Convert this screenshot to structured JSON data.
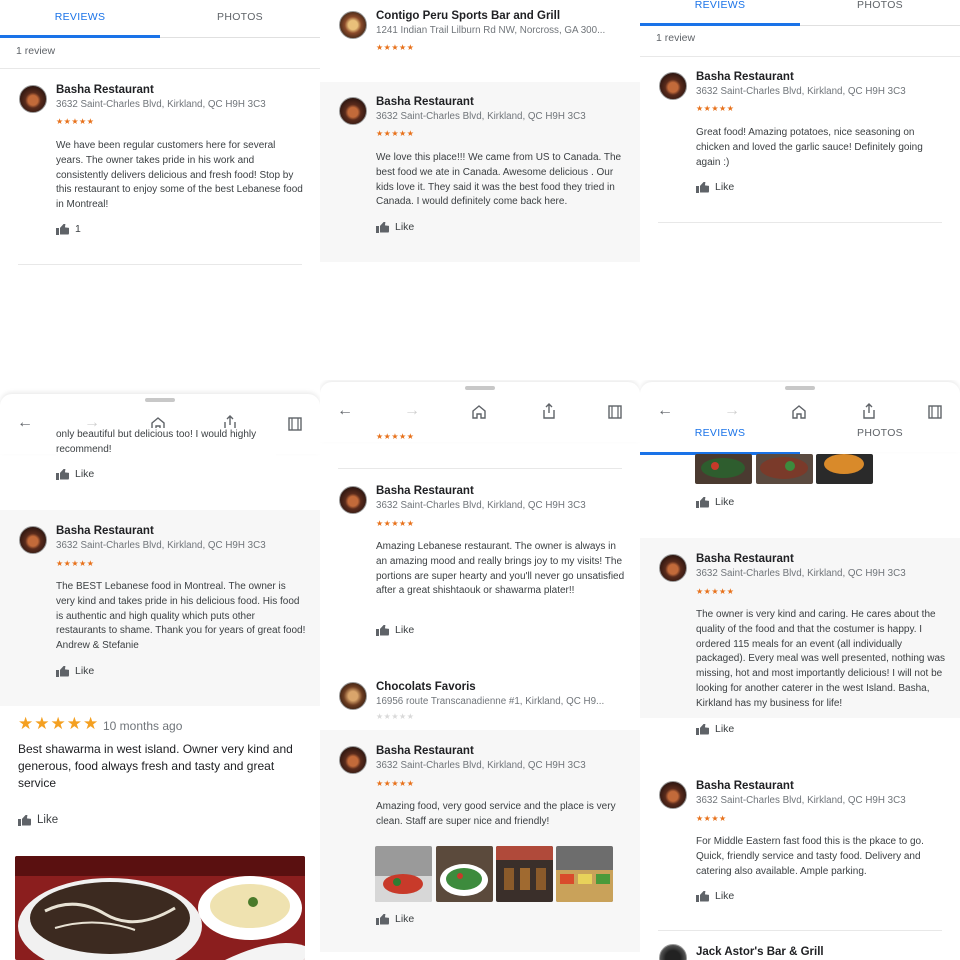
{
  "tabs": {
    "reviews": "REVIEWS",
    "photos": "PHOTOS"
  },
  "review_count": "1 review",
  "like_label": "Like",
  "basha": {
    "name": "Basha Restaurant",
    "address": "3632 Saint-Charles Blvd, Kirkland, QC H9H 3C3"
  },
  "stars5": "★★★★★",
  "stars4": "★★★★",
  "stars5_big": "★★★★★",
  "p1": {
    "text": "We have been regular customers here for several years. The owner takes pride in his work and consistently delivers delicious and fresh food! Stop by this restaurant to enjoy some of the best Lebanese food in Montreal!",
    "like_count": "1"
  },
  "p2": {
    "other_name": "Contigo Peru Sports Bar and Grill",
    "other_address": "1241 Indian Trail Lilburn Rd NW, Norcross, GA 300...",
    "text": "We love this place!!! We came from US to Canada. The best food we ate in Canada. Awesome delicious . Our kids love it. They said it was the best food they tried in Canada. I would definitely come back here."
  },
  "p3": {
    "text": "Great food! Amazing potatoes, nice seasoning on chicken and loved the garlic sauce! Definitely going again :)"
  },
  "p4": {
    "partial_text": "only beautiful but delicious too! I would highly recommend!",
    "text": "The BEST Lebanese food in Montreal. The owner is very kind and takes pride in his delicious food. His food is authentic and high quality which puts other restaurants to shame. Thank you for years of great food! Andrew & Stefanie",
    "time_ago": "10 months ago",
    "big_text": "Best shawarma in west island. Owner very kind and generous, food always fresh and tasty and great service"
  },
  "p5": {
    "text1": "Amazing Lebanese restaurant. The owner is always in an amazing mood and really brings joy to my visits! The portions are super hearty and you'll never go unsatisfied after a great shishtaouk or shawarma plater!!",
    "other_name": "Chocolats Favoris",
    "other_address": "16956 route Transcanadienne #1, Kirkland, QC H9...",
    "text2": "Amazing food, very good service and the place is very clean. Staff are super nice and friendly!"
  },
  "p6": {
    "text1": "The owner is very kind and caring. He cares about the quality of the food and that the costumer is happy. I ordered 115 meals for an event (all individually packaged). Every meal was well presented, nothing was missing, hot and most importantly delicious! I will not be looking for another caterer in the west Island. Basha, Kirkland has my business for life!",
    "text2": "For Middle Eastern fast food this is the pkace to go. Quick, friendly service and tasty food. Delivery and catering also available. Ample parking.",
    "other_name": "Jack Astor's Bar & Grill"
  },
  "colors": {
    "accent": "#1a73e8",
    "star": "#e7711b"
  },
  "icons": [
    "back-arrow-icon",
    "forward-arrow-icon",
    "home-icon",
    "share-icon",
    "tabs-icon",
    "thumbs-up-icon"
  ]
}
